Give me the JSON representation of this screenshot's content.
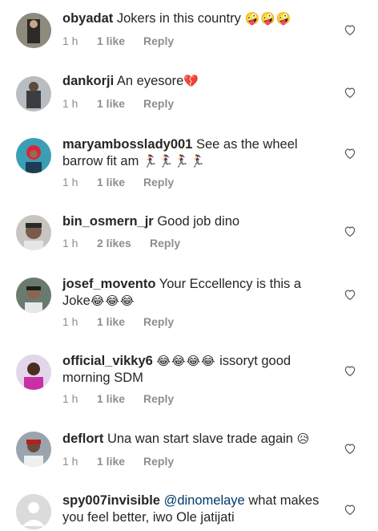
{
  "comments": [
    {
      "username": "obyadat",
      "text": "Jokers in this country",
      "emoji": "🤪🤪🤪",
      "time": "1 h",
      "likes": "1 like",
      "reply": "Reply"
    },
    {
      "username": "dankorji",
      "text": "An eyesore",
      "emoji": "💔",
      "time": "1 h",
      "likes": "1 like",
      "reply": "Reply"
    },
    {
      "username": "maryambosslady001",
      "text": "See as the wheel barrow fit am",
      "emoji": "🏃‍♀️🏃‍♀️🏃‍♀️🏃‍♀️",
      "time": "1 h",
      "likes": "1 like",
      "reply": "Reply"
    },
    {
      "username": "bin_osmern_jr",
      "text": "Good job dino",
      "time": "1 h",
      "likes": "2 likes",
      "reply": "Reply"
    },
    {
      "username": "josef_movento",
      "text": "Your Eccellency is this a Joke",
      "emoji": "😂😂😂",
      "time": "1 h",
      "likes": "1 like",
      "reply": "Reply"
    },
    {
      "username": "official_vikky6",
      "emoji": "😂😂😂😂",
      "text": "issoryt good morning SDM",
      "time": "1 h",
      "likes": "1 like",
      "reply": "Reply"
    },
    {
      "username": "deflort",
      "text": "Una wan start slave trade again",
      "emoji": "😥",
      "time": "1 h",
      "likes": "1 like",
      "reply": "Reply"
    },
    {
      "username": "spy007invisible",
      "mention": "@dinomelaye",
      "text": "what makes you feel better, iwo Ole jatijati"
    }
  ],
  "colors": {
    "text": "#262626",
    "meta": "#8e8e8e",
    "mention": "#00376b"
  },
  "icons": {
    "like": "heart-outline-icon",
    "avatar": "user-avatar"
  }
}
